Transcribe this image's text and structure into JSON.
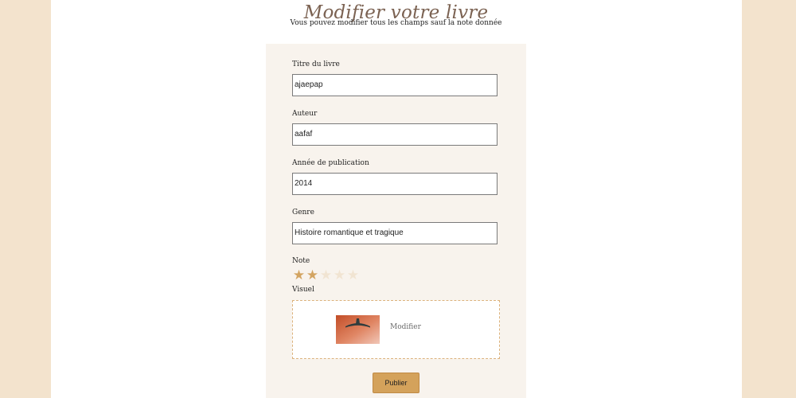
{
  "header": {
    "title": "Modifier votre livre",
    "subtitle": "Vous pouvez modifier tous les champs sauf la note donnée"
  },
  "form": {
    "title_label": "Titre du livre",
    "title_value": "ajaepap",
    "author_label": "Auteur",
    "author_value": "aafaf",
    "year_label": "Année de publication",
    "year_value": "2014",
    "genre_label": "Genre",
    "genre_value": "Histoire romantique et tragique",
    "rating_label": "Note",
    "rating": {
      "value": 2,
      "max": 5
    },
    "visual_label": "Visuel",
    "visual_modify": "Modifier",
    "submit_label": "Publier"
  },
  "colors": {
    "background": "#f3e3cd",
    "card": "#f8f3ed",
    "accent": "#d4a25b",
    "title": "#7b6252",
    "star_on": "#d3a461",
    "star_off": "#f1e4d2"
  }
}
